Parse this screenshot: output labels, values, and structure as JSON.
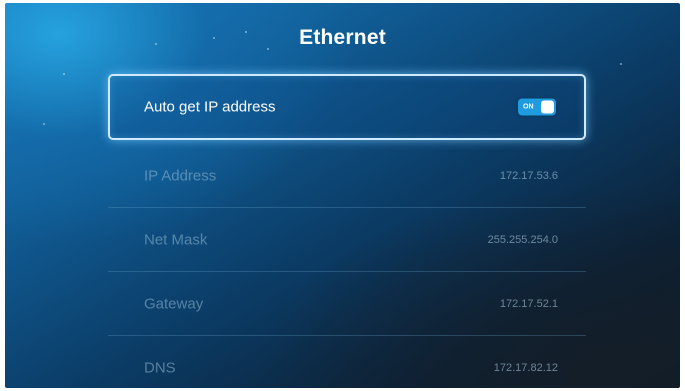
{
  "header": {
    "title": "Ethernet"
  },
  "settings": {
    "auto_ip": {
      "label": "Auto get IP address",
      "toggle_state": "ON"
    },
    "rows": [
      {
        "label": "IP Address",
        "value": "172.17.53.6"
      },
      {
        "label": "Net Mask",
        "value": "255.255.254.0"
      },
      {
        "label": "Gateway",
        "value": "172.17.52.1"
      },
      {
        "label": "DNS",
        "value": "172.17.82.12"
      }
    ]
  },
  "colors": {
    "accent": "#1f9be0",
    "focus_border": "#cfe9ff",
    "text_primary": "#ffffff"
  }
}
